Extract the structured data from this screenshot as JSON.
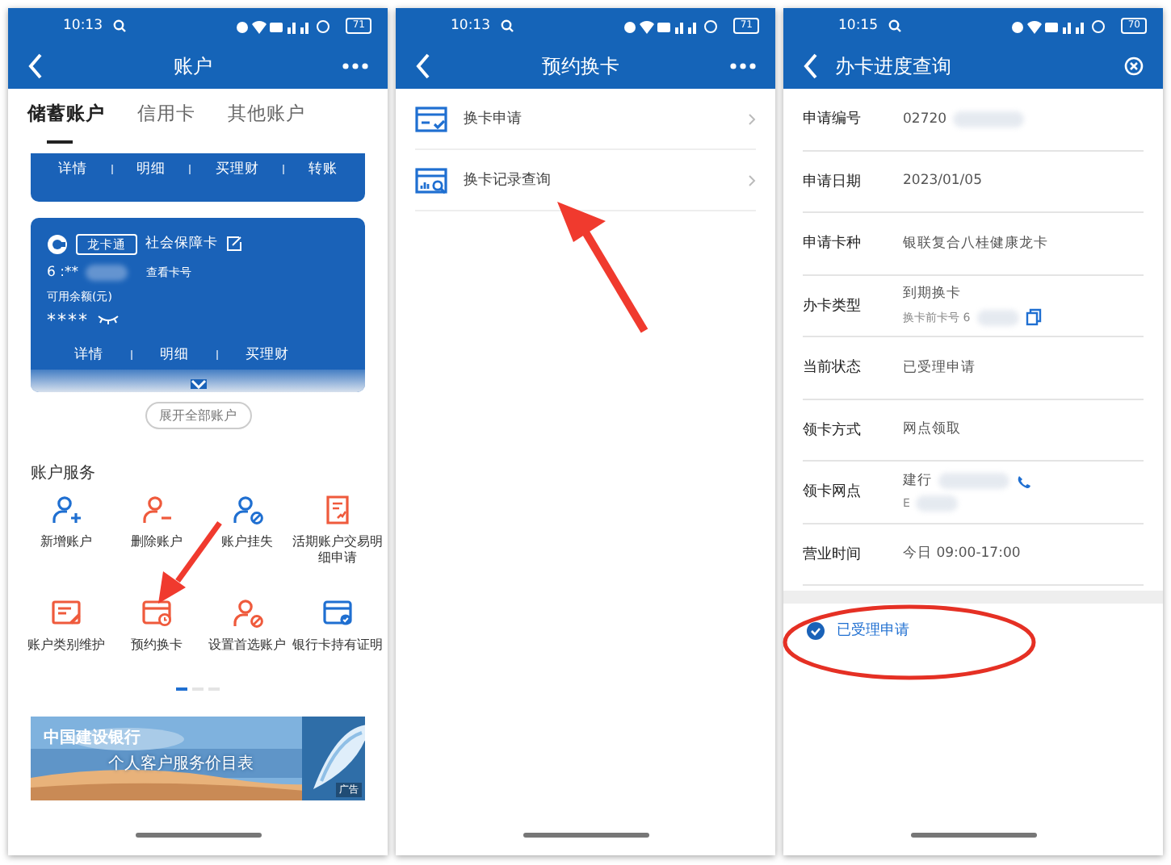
{
  "accounts_screen": {
    "status_bar": {
      "time": "10:13",
      "battery": "71"
    },
    "title": "账户",
    "tabs": [
      {
        "label": "储蓄账户",
        "selected": true
      },
      {
        "label": "信用卡",
        "selected": false
      },
      {
        "label": "其他账户",
        "selected": false
      }
    ],
    "top_card": {
      "actions": [
        "详情",
        "明细",
        "买理财",
        "转账"
      ]
    },
    "card": {
      "badge": "龙卡通",
      "name": "社会保障卡",
      "number": "6 :**",
      "view_number": "查看卡号",
      "balance_label": "可用余额(元)",
      "balance": "****",
      "actions": [
        "详情",
        "明细",
        "买理财"
      ]
    },
    "expand_button": "展开全部账户",
    "section_title": "账户服务",
    "services": [
      {
        "label": "新增账户",
        "kind": "person-add",
        "color": "#1f6fd1"
      },
      {
        "label": "删除账户",
        "kind": "person-remove",
        "color": "#ef5a3c"
      },
      {
        "label": "账户挂失",
        "kind": "person-block",
        "color": "#1f6fd1"
      },
      {
        "label": "活期账户交易明细申请",
        "kind": "document",
        "color": "#ef5a3c"
      },
      {
        "label": "账户类别维护",
        "kind": "form-edit",
        "color": "#ef5a3c"
      },
      {
        "label": "预约换卡",
        "kind": "card-clock",
        "color": "#ef5a3c"
      },
      {
        "label": "设置首选账户",
        "kind": "person-block",
        "color": "#ef5a3c"
      },
      {
        "label": "银行卡持有证明",
        "kind": "card-badge",
        "color": "#1f6fd1"
      }
    ],
    "pager": [
      {
        "selected": true
      },
      {
        "selected": false
      },
      {
        "selected": false
      }
    ],
    "banner": {
      "title": "中国建设银行",
      "subtitle": "个人客户服务价目表",
      "tag": "广告"
    }
  },
  "card_replacement_screen": {
    "status_bar": {
      "time": "10:13",
      "battery": "71"
    },
    "title": "预约换卡",
    "items": [
      {
        "label": "换卡申请",
        "kind": "card-check"
      },
      {
        "label": "换卡记录查询",
        "kind": "chart-search"
      }
    ]
  },
  "progress_screen": {
    "status_bar": {
      "time": "10:15",
      "battery": "70"
    },
    "title": "办卡进度查询",
    "rows": [
      {
        "label": "申请编号",
        "value": "02720"
      },
      {
        "label": "申请日期",
        "value": "2023/01/05"
      },
      {
        "label": "申请卡种",
        "value": "银联复合八桂健康龙卡"
      },
      {
        "label": "办卡类型",
        "value": "到期换卡",
        "sub": "换卡前卡号 6",
        "kind": "copy"
      },
      {
        "label": "当前状态",
        "value": "已受理申请"
      },
      {
        "label": "领卡方式",
        "value": "网点领取"
      },
      {
        "label": "领卡网点",
        "value": "建行",
        "sub": "E",
        "kind": "phone"
      },
      {
        "label": "营业时间",
        "value": "今日 09:00-17:00"
      }
    ],
    "steps": [
      {
        "label": "已受理申请",
        "done": true
      }
    ]
  }
}
